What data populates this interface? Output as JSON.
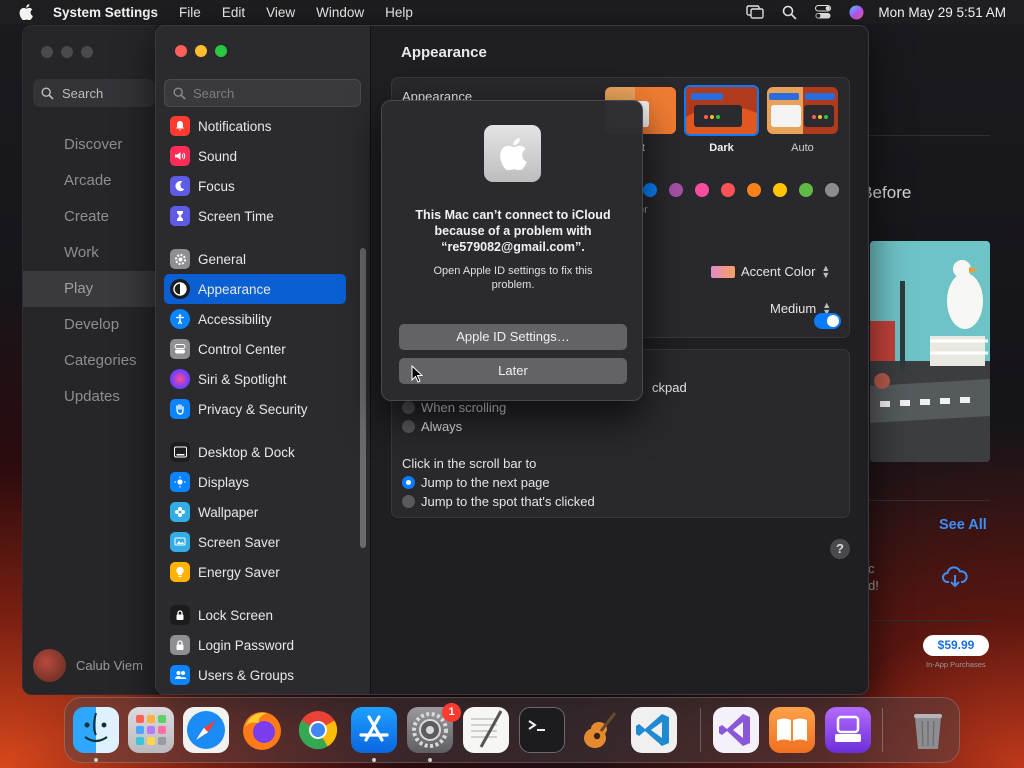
{
  "menubar": {
    "app_name": "System Settings",
    "menus": [
      "File",
      "Edit",
      "View",
      "Window",
      "Help"
    ],
    "clock": "Mon May 29  5:51 AM"
  },
  "store": {
    "search_label": "Search",
    "nav": [
      "Discover",
      "Arcade",
      "Create",
      "Work",
      "Play",
      "Develop",
      "Categories",
      "Updates"
    ],
    "active_nav": "Play",
    "user_name": "Calub Viem",
    "heading_fragment": "s Before",
    "see_all": "See All",
    "text_fragment_1": "c",
    "text_fragment_2": "d!",
    "price": "$59.99",
    "in_app": "In-App Purchases"
  },
  "settings": {
    "search_placeholder": "Search",
    "sidebar": [
      {
        "label": "Notifications",
        "icon": "bell-icon",
        "color": "#ff3b30"
      },
      {
        "label": "Sound",
        "icon": "speaker-icon",
        "color": "#ff2d55"
      },
      {
        "label": "Focus",
        "icon": "moon-icon",
        "color": "#5e5ce6"
      },
      {
        "label": "Screen Time",
        "icon": "hourglass-icon",
        "color": "#5e5ce6"
      },
      {
        "label": "General",
        "icon": "gear-icon",
        "color": "#8e8e93"
      },
      {
        "label": "Appearance",
        "icon": "appearance-icon",
        "color": "#1c1c1e"
      },
      {
        "label": "Accessibility",
        "icon": "accessibility-icon",
        "color": "#0a84ff"
      },
      {
        "label": "Control Center",
        "icon": "control-center-icon",
        "color": "#8e8e93"
      },
      {
        "label": "Siri & Spotlight",
        "icon": "siri-icon",
        "color": "#bf5af2"
      },
      {
        "label": "Privacy & Security",
        "icon": "hand-icon",
        "color": "#0a84ff"
      },
      {
        "label": "Desktop & Dock",
        "icon": "dock-icon",
        "color": "#1c1c1e"
      },
      {
        "label": "Displays",
        "icon": "sun-icon",
        "color": "#0a84ff"
      },
      {
        "label": "Wallpaper",
        "icon": "flower-icon",
        "color": "#32ade6"
      },
      {
        "label": "Screen Saver",
        "icon": "screensaver-icon",
        "color": "#32ade6"
      },
      {
        "label": "Energy Saver",
        "icon": "bulb-icon",
        "color": "#ffb300"
      },
      {
        "label": "Lock Screen",
        "icon": "lock-icon",
        "color": "#1c1c1e"
      },
      {
        "label": "Login Password",
        "icon": "login-lock-icon",
        "color": "#8e8e93"
      },
      {
        "label": "Users & Groups",
        "icon": "users-icon",
        "color": "#0a84ff"
      }
    ],
    "main": {
      "title": "Appearance",
      "appearance_label": "Appearance",
      "mode_options": [
        "nt",
        "Dark",
        "Auto"
      ],
      "selected_mode": "Dark",
      "accent_colors": [
        "#0a84ff",
        "#a550a7",
        "#f74f9e",
        "#ff5257",
        "#f7821b",
        "#ffc600",
        "#62ba46",
        "#8c8c8c"
      ],
      "highlight_fragment": "or",
      "highlight_value": "Accent Color",
      "sidebar_size_value": "Medium",
      "scroll_fragment": "ckpad",
      "scroll_options": [
        "When scrolling",
        "Always"
      ],
      "click_label": "Click in the scroll bar to",
      "click_options": [
        "Jump to the next page",
        "Jump to the spot that's clicked"
      ],
      "help": "?"
    }
  },
  "dialog": {
    "title": "This Mac can’t connect to iCloud because of a problem with “re579082@gmail.com”.",
    "message": "Open Apple ID settings to fix this problem.",
    "primary_button": "Apple ID Settings…",
    "secondary_button": "Later"
  },
  "dock": {
    "settings_badge": "1",
    "apps": [
      "finder-icon",
      "launchpad-icon",
      "safari-icon",
      "firefox-icon",
      "chrome-icon",
      "app-store-icon",
      "system-settings-icon",
      "textedit-icon",
      "terminal-icon",
      "garageband-icon",
      "vscode-icon",
      "visual-studio-icon",
      "books-icon",
      "podcasts-like-icon",
      "trash-icon"
    ]
  }
}
